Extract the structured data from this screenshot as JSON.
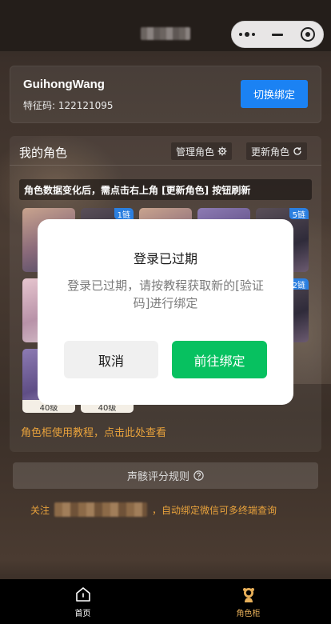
{
  "header": {
    "menu_icon": "more-dots-icon",
    "minimize_icon": "minus-icon",
    "close_icon": "target-icon"
  },
  "user": {
    "name": "GuihongWang",
    "feature_code": "特征码: 122121095",
    "switch_label": "切换绑定"
  },
  "roles": {
    "title": "我的角色",
    "manage_label": "管理角色",
    "refresh_label": "更新角色",
    "notice": "角色数据变化后，需点击右上角 [更新角色] 按钮刷新",
    "characters": [
      {
        "badge": "",
        "level": ""
      },
      {
        "badge": "1链",
        "level": ""
      },
      {
        "badge": "",
        "level": ""
      },
      {
        "badge": "",
        "level": ""
      },
      {
        "badge": "5链",
        "level": ""
      },
      {
        "badge": "",
        "level": ""
      },
      {
        "badge": "2链",
        "level": ""
      },
      {
        "badge": "",
        "level": "40级"
      },
      {
        "badge": "",
        "level": "40级"
      }
    ],
    "tutorial_link": "角色柜使用教程，点击此处查看"
  },
  "rules_button": "声骸评分规则",
  "follow": {
    "prefix": "关注",
    "suffix": "，自动绑定微信可多终端查询"
  },
  "tabs": [
    {
      "label": "首页",
      "icon": "home-icon"
    },
    {
      "label": "角色柜",
      "icon": "character-icon"
    }
  ],
  "modal": {
    "title": "登录已过期",
    "message": "登录已过期，请按教程获取新的[验证码]进行绑定",
    "cancel_label": "取消",
    "confirm_label": "前往绑定"
  },
  "colors": {
    "primary_blue": "#1b82f3",
    "confirm_green": "#07c160",
    "accent_orange": "#e8a23c",
    "active_tab": "#e8b05a"
  }
}
